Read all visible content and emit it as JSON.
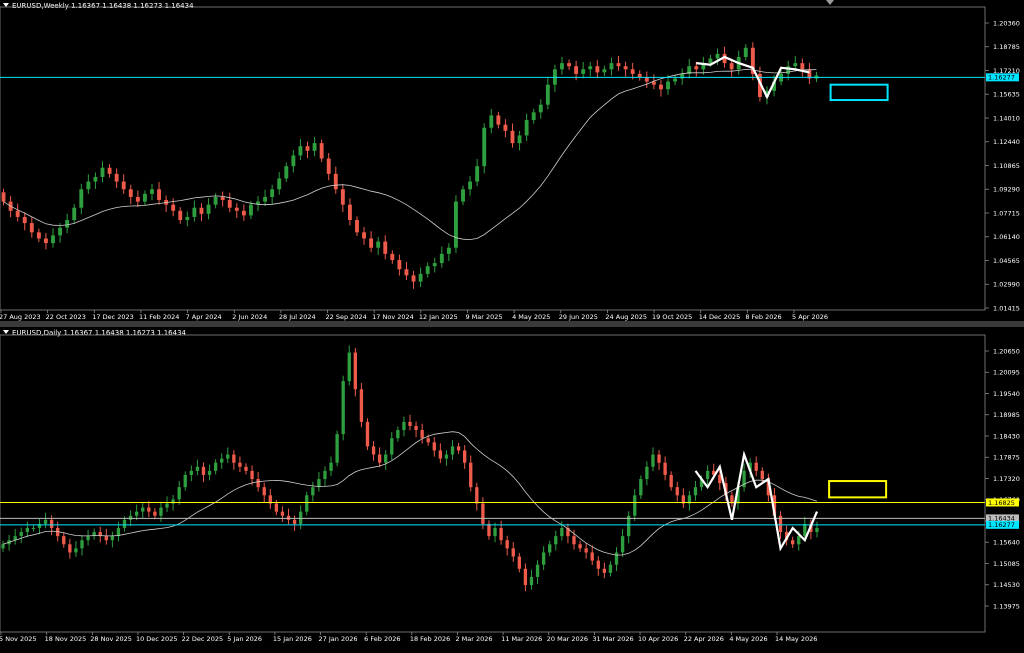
{
  "chart_data": [
    {
      "type": "candlestick",
      "symbol": "EURUSD",
      "timeframe": "Weekly",
      "title": "EURUSD,Weekly  1.16367 1.16438 1.16273 1.16434",
      "ylim": [
        1.0115,
        1.2085
      ],
      "y_ticks": [
        "1.20360",
        "1.18785",
        "1.17210",
        "1.15635",
        "1.14010",
        "1.12440",
        "1.10865",
        "1.09290",
        "1.07715",
        "1.06140",
        "1.04565",
        "1.02990",
        "1.01415"
      ],
      "x_ticks": [
        "27 Aug 2023",
        "22 Oct 2023",
        "17 Dec 2023",
        "11 Feb 2024",
        "7 Apr 2024",
        "2 Jun 2024",
        "28 Jul 2024",
        "22 Sep 2024",
        "17 Nov 2024",
        "12 Jan 2025",
        "9 Mar 2025",
        "4 May 2025",
        "29 Jun 2025",
        "24 Aug 2025",
        "19 Oct 2025",
        "14 Dec 2025",
        "8 Feb 2026",
        "5 Apr 2026"
      ],
      "closes": [
        1.082,
        1.076,
        1.072,
        1.068,
        1.062,
        1.058,
        1.055,
        1.06,
        1.065,
        1.07,
        1.078,
        1.09,
        1.095,
        1.098,
        1.104,
        1.1,
        1.095,
        1.09,
        1.085,
        1.082,
        1.087,
        1.09,
        1.083,
        1.08,
        1.076,
        1.07,
        1.072,
        1.078,
        1.074,
        1.08,
        1.085,
        1.083,
        1.078,
        1.076,
        1.073,
        1.08,
        1.082,
        1.085,
        1.09,
        1.097,
        1.105,
        1.112,
        1.118,
        1.115,
        1.12,
        1.11,
        1.1,
        1.09,
        1.08,
        1.07,
        1.062,
        1.058,
        1.052,
        1.056,
        1.048,
        1.044,
        1.038,
        1.034,
        1.03,
        1.035,
        1.04,
        1.042,
        1.048,
        1.052,
        1.082,
        1.09,
        1.095,
        1.105,
        1.13,
        1.138,
        1.132,
        1.128,
        1.12,
        1.125,
        1.135,
        1.14,
        1.145,
        1.158,
        1.168,
        1.172,
        1.17,
        1.165,
        1.168,
        1.17,
        1.166,
        1.168,
        1.172,
        1.17,
        1.168,
        1.165,
        1.163,
        1.16,
        1.158,
        1.155,
        1.16,
        1.162,
        1.165,
        1.17,
        1.168,
        1.172,
        1.175,
        1.178,
        1.172,
        1.168,
        1.176,
        1.182,
        1.165,
        1.15,
        1.154,
        1.16,
        1.165,
        1.17,
        1.172,
        1.168,
        1.162,
        1.164
      ],
      "moving_average": {
        "period_note": "",
        "color": "#cfcfcf"
      },
      "horizontal_levels": [
        {
          "value": "1.16277",
          "color": "#00e5ff"
        }
      ],
      "zigzag_color": "#ffffff",
      "target_box_color": "#00e5ff",
      "colors": {
        "bull": "#2e9e3f",
        "bear": "#ef5b4b",
        "background": "#000000"
      }
    },
    {
      "type": "candlestick",
      "symbol": "EURUSD",
      "timeframe": "Daily",
      "title": "EURUSD,Daily  1.16367 1.16438 1.16273 1.16434",
      "ylim": [
        1.1365,
        1.2093
      ],
      "y_ticks": [
        "1.20650",
        "1.20095",
        "1.19540",
        "1.18985",
        "1.18430",
        "1.17875",
        "1.17320",
        "1.16760",
        "1.16205",
        "1.15640",
        "1.15085",
        "1.14530",
        "1.13975"
      ],
      "x_ticks": [
        "5 Nov 2025",
        "18 Nov 2025",
        "28 Nov 2025",
        "10 Dec 2025",
        "22 Dec 2025",
        "5 Jan 2026",
        "15 Jan 2026",
        "27 Jan 2026",
        "6 Feb 2026",
        "18 Feb 2026",
        "2 Mar 2026",
        "11 Mar 2026",
        "20 Mar 2026",
        "31 Mar 2026",
        "10 Apr 2026",
        "22 Apr 2026",
        "4 May 2026",
        "14 May 2026"
      ],
      "closes": [
        1.158,
        1.159,
        1.16,
        1.161,
        1.162,
        1.162,
        1.163,
        1.164,
        1.162,
        1.16,
        1.158,
        1.156,
        1.157,
        1.159,
        1.16,
        1.161,
        1.16,
        1.159,
        1.16,
        1.162,
        1.164,
        1.165,
        1.166,
        1.167,
        1.166,
        1.165,
        1.167,
        1.168,
        1.169,
        1.172,
        1.175,
        1.176,
        1.177,
        1.175,
        1.176,
        1.178,
        1.179,
        1.18,
        1.178,
        1.177,
        1.176,
        1.174,
        1.172,
        1.17,
        1.168,
        1.166,
        1.165,
        1.164,
        1.163,
        1.166,
        1.17,
        1.172,
        1.174,
        1.176,
        1.178,
        1.185,
        1.198,
        1.205,
        1.196,
        1.188,
        1.182,
        1.18,
        1.178,
        1.18,
        1.184,
        1.186,
        1.188,
        1.187,
        1.186,
        1.184,
        1.183,
        1.181,
        1.179,
        1.18,
        1.182,
        1.181,
        1.178,
        1.172,
        1.168,
        1.163,
        1.16,
        1.162,
        1.159,
        1.157,
        1.155,
        1.152,
        1.148,
        1.15,
        1.153,
        1.156,
        1.158,
        1.16,
        1.162,
        1.16,
        1.158,
        1.157,
        1.156,
        1.154,
        1.152,
        1.151,
        1.153,
        1.156,
        1.16,
        1.165,
        1.17,
        1.174,
        1.177,
        1.18,
        1.178,
        1.175,
        1.172,
        1.17,
        1.168,
        1.17,
        1.172,
        1.174,
        1.176,
        1.175,
        1.173,
        1.17,
        1.168,
        1.172,
        1.176,
        1.178,
        1.176,
        1.174,
        1.17,
        1.165,
        1.161,
        1.159,
        1.158,
        1.16,
        1.163,
        1.161,
        1.162
      ],
      "moving_average": {
        "period_note": "",
        "color": "#cfcfcf"
      },
      "horizontal_levels": [
        {
          "value": "1.16825",
          "color": "#ffff00"
        },
        {
          "value": "1.16434",
          "color": "#bdbdbd"
        },
        {
          "value": "1.16277",
          "color": "#00e5ff"
        }
      ],
      "zigzag_color": "#ffffff",
      "target_box_color": "#ffff00",
      "colors": {
        "bull": "#2e9e3f",
        "bear": "#ef5b4b",
        "background": "#000000"
      }
    }
  ]
}
